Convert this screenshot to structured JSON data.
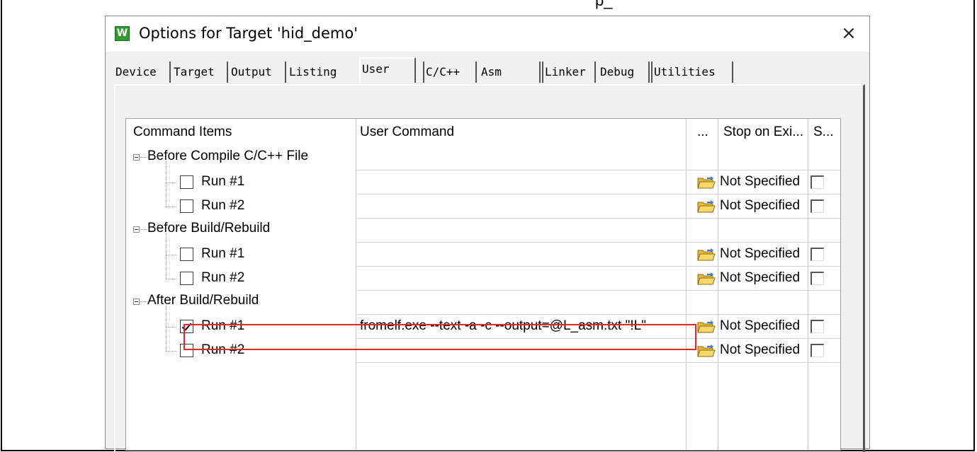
{
  "page_top_partial": "p_",
  "dialog": {
    "title": "Options for Target 'hid_demo'",
    "app_icon_glyph": "W",
    "close_glyph": "×"
  },
  "tabs": [
    {
      "label": "Device",
      "active": false
    },
    {
      "label": "Target",
      "active": false
    },
    {
      "label": "Output",
      "active": false
    },
    {
      "label": "Listing",
      "active": false
    },
    {
      "label": "User",
      "active": true
    },
    {
      "label": "C/C++",
      "active": false
    },
    {
      "label": "Asm",
      "active": false
    },
    {
      "label": "Linker",
      "active": false
    },
    {
      "label": "Debug",
      "active": false
    },
    {
      "label": "Utilities",
      "active": false
    }
  ],
  "columns": {
    "command_items": "Command Items",
    "user_command": "User Command",
    "browse": "...",
    "stop_on_exit": "Stop on Exi...",
    "s": "S..."
  },
  "groups": [
    {
      "label": "Before Compile C/C++ File",
      "items": [
        {
          "label": "Run #1",
          "checked": false,
          "command": "",
          "stop": "Not Specified",
          "s_checked": false
        },
        {
          "label": "Run #2",
          "checked": false,
          "command": "",
          "stop": "Not Specified",
          "s_checked": false
        }
      ]
    },
    {
      "label": "Before Build/Rebuild",
      "items": [
        {
          "label": "Run #1",
          "checked": false,
          "command": "",
          "stop": "Not Specified",
          "s_checked": false
        },
        {
          "label": "Run #2",
          "checked": false,
          "command": "",
          "stop": "Not Specified",
          "s_checked": false
        }
      ]
    },
    {
      "label": "After Build/Rebuild",
      "items": [
        {
          "label": "Run #1",
          "checked": true,
          "command": "fromelf.exe --text -a -c --output=@L_asm.txt \"!L\"",
          "stop": "Not Specified",
          "s_checked": false
        },
        {
          "label": "Run #2",
          "checked": false,
          "command": "",
          "stop": "Not Specified",
          "s_checked": false
        }
      ]
    }
  ],
  "colors": {
    "highlight_border": "#e32626",
    "dialog_bg": "#f0f0f0",
    "icon_green": "#2f9a35",
    "folder_yellow": "#f3c94a"
  },
  "icons": {
    "app": "keil-uvision-icon",
    "close": "close-icon",
    "browse": "folder-open-icon",
    "tree_toggle": "tree-collapse-icon"
  }
}
